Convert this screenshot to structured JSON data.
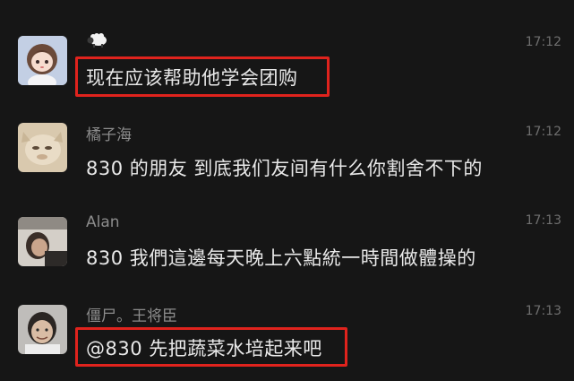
{
  "messages": [
    {
      "sender": "",
      "sender_icon": "sheep-icon",
      "time": "17:12",
      "text": "现在应该帮助他学会团购",
      "highlighted": true
    },
    {
      "sender": "橘子海",
      "time": "17:12",
      "text": "830 的朋友 到底我们友间有什么你割舍不下的",
      "highlighted": false
    },
    {
      "sender": "Alan",
      "time": "17:13",
      "text": "830 我們這邊每天晚上六點統一時間做體操的",
      "highlighted": false
    },
    {
      "sender": "僵尸。王将臣",
      "time": "17:13",
      "text": "@830 先把蔬菜水培起来吧",
      "highlighted": true
    }
  ],
  "colors": {
    "background": "#161616",
    "highlight": "#e0231d",
    "text": "#e9e9e9",
    "sender": "#8c8c8c"
  }
}
